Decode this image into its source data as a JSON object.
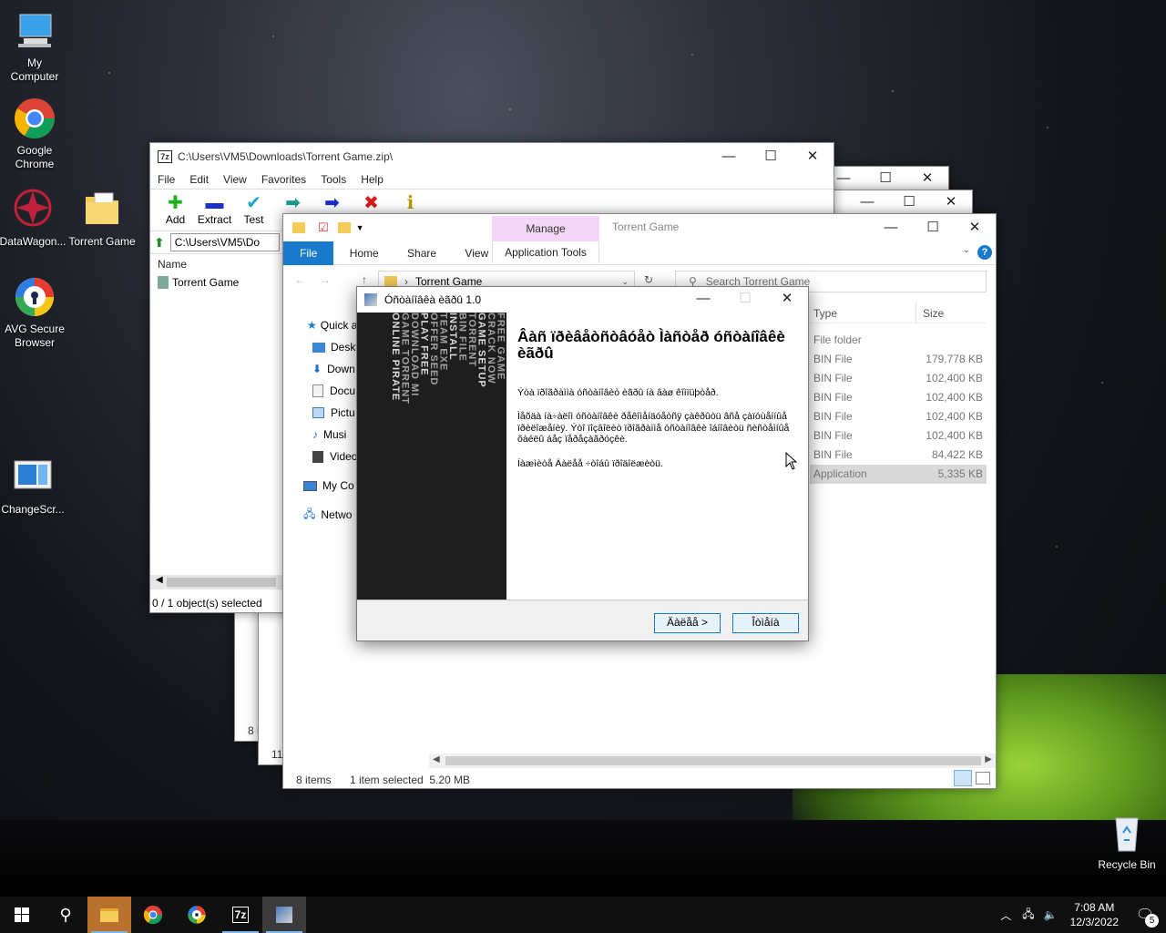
{
  "desktop": {
    "icons": [
      {
        "label": "My\nComputer"
      },
      {
        "label": "Google\nChrome"
      },
      {
        "label": "DataWagon..."
      },
      {
        "label": "Torrent Game"
      },
      {
        "label": "AVG Secure\nBrowser"
      },
      {
        "label": "ChangeScr..."
      },
      {
        "label": "Recycle Bin"
      }
    ]
  },
  "sevenzip": {
    "title": "C:\\Users\\VM5\\Downloads\\Torrent Game.zip\\",
    "menu": [
      "File",
      "Edit",
      "View",
      "Favorites",
      "Tools",
      "Help"
    ],
    "toolbar": [
      "Add",
      "Extract",
      "Test",
      "C"
    ],
    "path": "C:\\Users\\VM5\\Do",
    "column_name": "Name",
    "item": "Torrent Game",
    "status": "0 / 1 object(s) selected"
  },
  "explorer": {
    "manage_tab": "Manage",
    "title": "Torrent Game",
    "tabs": [
      "File",
      "Home",
      "Share",
      "View",
      "Application Tools"
    ],
    "breadcrumb": "Torrent Game",
    "search_placeholder": "Search Torrent Game",
    "nav": [
      "Quick a",
      "Deskt",
      "Down",
      "Docu",
      "Pictu",
      "Musi",
      "Video",
      "My Co",
      "Netwo"
    ],
    "columns": {
      "type": "Type",
      "size": "Size"
    },
    "rows": [
      {
        "type": "File folder",
        "size": ""
      },
      {
        "type": "BIN File",
        "size": "179,778 KB"
      },
      {
        "type": "BIN File",
        "size": "102,400 KB"
      },
      {
        "type": "BIN File",
        "size": "102,400 KB"
      },
      {
        "type": "BIN File",
        "size": "102,400 KB"
      },
      {
        "type": "BIN File",
        "size": "102,400 KB"
      },
      {
        "type": "BIN File",
        "size": "84,422 KB"
      },
      {
        "type": "Application",
        "size": "5,335 KB"
      }
    ],
    "status_items": "8 items",
    "status_selected": "1 item selected  5.20 MB"
  },
  "background_windows": {
    "partial_1": "8 i",
    "partial_2": "11"
  },
  "dialog": {
    "title": "Óñòàíîâêà èãðû 1.0",
    "heading": "Âàñ ïðèâåòñòâóåò Ìàñòåð óñòàíîâêè èãðû",
    "para1": "Ýòà ïðîãðàììà óñòàíîâèò èãðû íà âàø êîìïüþòåð.",
    "para2": "Ìåõäà íà÷àëîì óñòàíîâêè ðåêîìåíäóåòñÿ çàêðûòü âñå çàïóùåííûå ïðèëîæåíèÿ. Ýòî ïîçâîëèò ïðîãðàììå óñòàíîâêè îáíîâèòü ñèñòåìíûå ôàéëû áåç ïåðåçàãðóçêè.",
    "para3": "Íàæìèòå Äàëåå ÷òîáû ïðîäîëæèòü.",
    "next_button": "Äàëåå >",
    "cancel_button": "Îòìåíà",
    "side_text": [
      "ONLINE PIRATE",
      "GAME TORRENT",
      "DOWNLOAD MI",
      "PLAY FREE",
      "OFFER SEED",
      "TEAM EXE",
      "INSTALL",
      "BIN FILE",
      "TORRENT",
      "GAME SETUP",
      "CRACK NOW",
      "FREE GAME"
    ]
  },
  "taskbar": {
    "time": "7:08 AM",
    "date": "12/3/2022",
    "notifications": "5"
  },
  "colors": {
    "accent": "#0078d7",
    "manage_tab": "#f4d7f6",
    "selected_row": "#cce8ff"
  }
}
